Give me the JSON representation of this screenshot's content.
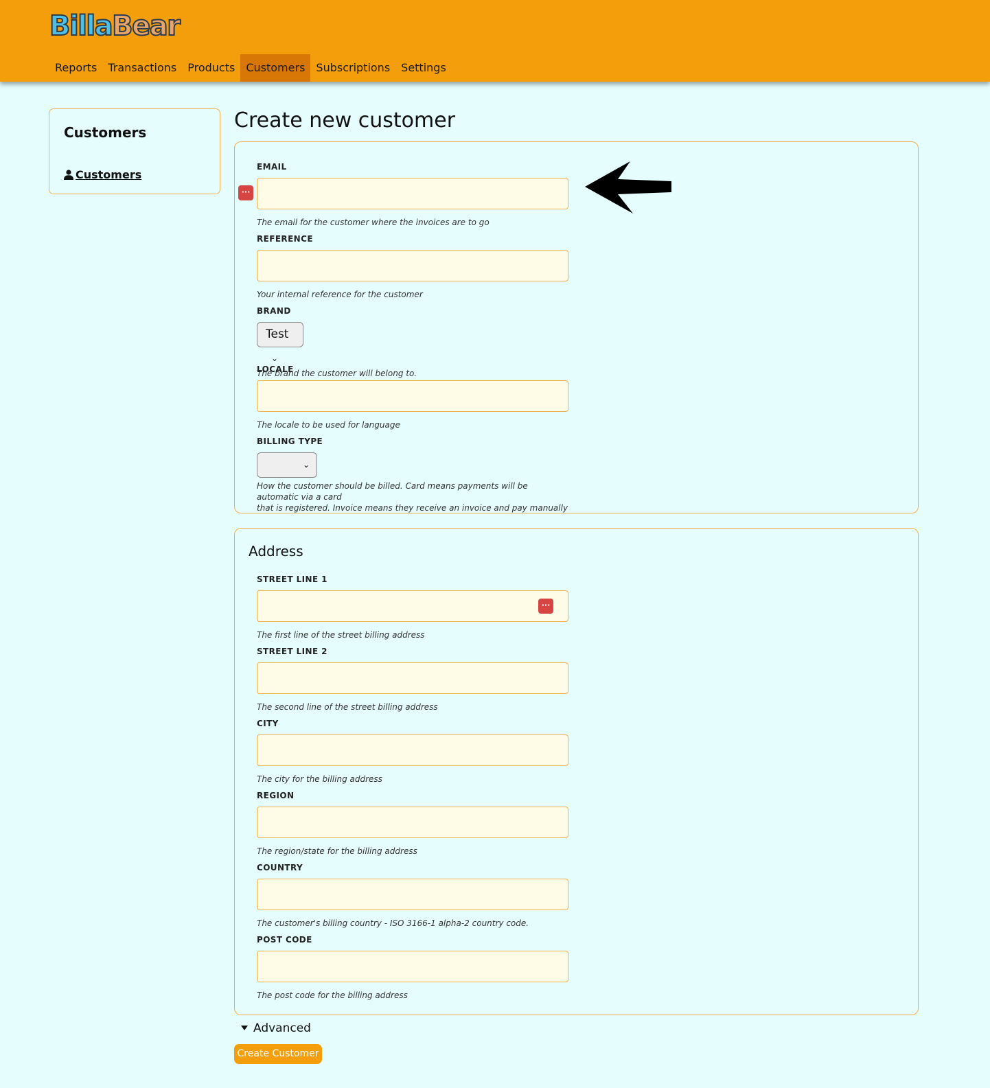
{
  "header": {
    "logo": {
      "part1": "Billa",
      "part2": "Bear"
    },
    "nav": [
      {
        "label": "Reports",
        "active": false
      },
      {
        "label": "Transactions",
        "active": false
      },
      {
        "label": "Products",
        "active": false
      },
      {
        "label": "Customers",
        "active": true
      },
      {
        "label": "Subscriptions",
        "active": false
      },
      {
        "label": "Settings",
        "active": false
      }
    ],
    "bg_color": "#f59e0b",
    "active_color": "#d97706"
  },
  "sidebar": {
    "title": "Customers",
    "items": [
      {
        "label": "Customers",
        "icon": "user-icon"
      }
    ]
  },
  "main": {
    "title": "Create new customer",
    "fields": {
      "email": {
        "label": "EMAIL",
        "value": "",
        "help": "The email for the customer where the invoices are to go"
      },
      "reference": {
        "label": "REFERENCE",
        "value": "",
        "help": "Your internal reference for the customer"
      },
      "brand": {
        "label": "BRAND",
        "selected": "Test",
        "help": "The brand the customer will belong to."
      },
      "locale": {
        "label": "LOCALE",
        "value": "",
        "help": "The locale to be used for language"
      },
      "billing_type": {
        "label": "BILLING TYPE",
        "selected": "",
        "help_line1": "How the customer should be billed. Card means payments will be automatic via a card",
        "help_line2": "that is registered. Invoice means they receive an invoice and pay manually"
      }
    }
  },
  "address": {
    "title": "Address",
    "fields": {
      "street1": {
        "label": "STREET LINE 1",
        "value": "",
        "help": "The first line of the street billing address"
      },
      "street2": {
        "label": "STREET LINE 2",
        "value": "",
        "help": "The second line of the street billing address"
      },
      "city": {
        "label": "CITY",
        "value": "",
        "help": "The city for the billing address"
      },
      "region": {
        "label": "REGION",
        "value": "",
        "help": "The region/state for the billing address"
      },
      "country": {
        "label": "COUNTRY",
        "value": "",
        "help": "The customer's billing country - ISO 3166-1 alpha-2 country code."
      },
      "postcode": {
        "label": "POST CODE",
        "value": "",
        "help": "The post code for the billing address"
      }
    }
  },
  "advanced": {
    "label": "Advanced"
  },
  "actions": {
    "create_label": "Create Customer"
  },
  "icons": {
    "password_manager": "password-manager-icon",
    "arrow": "arrow-left-icon",
    "user": "user-icon"
  },
  "colors": {
    "page_bg": "#e6fdfd",
    "input_bg": "#fefbe6",
    "border": "#f0b050",
    "pw_icon": "#d64541"
  }
}
